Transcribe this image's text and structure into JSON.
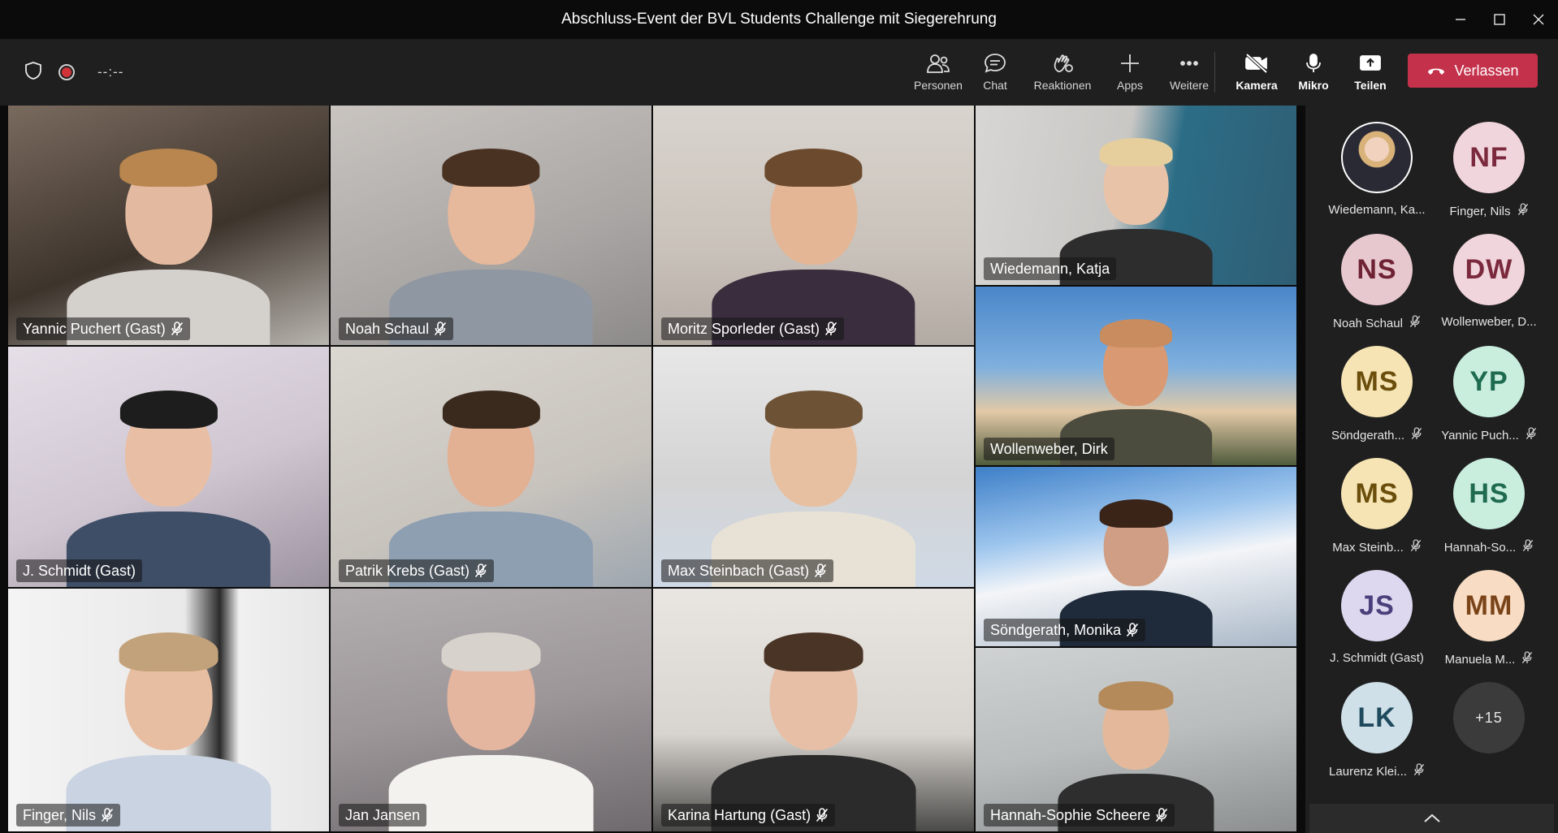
{
  "window": {
    "title": "Abschluss-Event der BVL Students Challenge mit Siegerehrung"
  },
  "toolbar": {
    "timer": "--:--",
    "actions": [
      {
        "label": "Personen",
        "icon": "people-icon"
      },
      {
        "label": "Chat",
        "icon": "chat-icon"
      },
      {
        "label": "Reaktionen",
        "icon": "reactions-icon"
      },
      {
        "label": "Apps",
        "icon": "plus-icon"
      },
      {
        "label": "Weitere",
        "icon": "more-icon"
      }
    ],
    "controls": [
      {
        "label": "Kamera",
        "icon": "camera-off-icon"
      },
      {
        "label": "Mikro",
        "icon": "mic-icon"
      },
      {
        "label": "Teilen",
        "icon": "share-icon"
      }
    ],
    "leave_label": "Verlassen"
  },
  "video_tiles": [
    {
      "name": "Yannic Puchert (Gast)",
      "muted": true
    },
    {
      "name": "Noah Schaul",
      "muted": true
    },
    {
      "name": "Moritz Sporleder (Gast)",
      "muted": true
    },
    {
      "name": "Wiedemann, Katja",
      "muted": false
    },
    {
      "name": "Wollenweber, Dirk",
      "muted": false
    },
    {
      "name": "J. Schmidt (Gast)",
      "muted": false
    },
    {
      "name": "Patrik Krebs (Gast)",
      "muted": true
    },
    {
      "name": "Max Steinbach (Gast)",
      "muted": true
    },
    {
      "name": "Söndgerath, Monika",
      "muted": true
    },
    {
      "name": "Finger, Nils",
      "muted": true
    },
    {
      "name": "Jan Jansen",
      "muted": false
    },
    {
      "name": "Karina Hartung (Gast)",
      "muted": true
    },
    {
      "name": "Hannah-Sophie Scheere",
      "muted": true
    }
  ],
  "participants": [
    {
      "initials": "",
      "name": "Wiedemann, Ka...",
      "muted": false,
      "photo": true
    },
    {
      "initials": "NF",
      "name": "Finger, Nils",
      "muted": true,
      "bg": "#f1d5dc",
      "fg": "#7a2a3c"
    },
    {
      "initials": "NS",
      "name": "Noah Schaul",
      "muted": true,
      "bg": "#e8c8cf",
      "fg": "#6e2233"
    },
    {
      "initials": "DW",
      "name": "Wollenweber, D...",
      "muted": false,
      "bg": "#f1d5dc",
      "fg": "#7a2a3c"
    },
    {
      "initials": "MS",
      "name": "Söndgerath...",
      "muted": true,
      "bg": "#f6e4b4",
      "fg": "#6b4e0c"
    },
    {
      "initials": "YP",
      "name": "Yannic Puch...",
      "muted": true,
      "bg": "#c9eede",
      "fg": "#1f6b4f"
    },
    {
      "initials": "MS",
      "name": "Max Steinb...",
      "muted": true,
      "bg": "#f6e4b4",
      "fg": "#6b4e0c"
    },
    {
      "initials": "HS",
      "name": "Hannah-So...",
      "muted": true,
      "bg": "#c9eede",
      "fg": "#1f6b4f"
    },
    {
      "initials": "JS",
      "name": "J. Schmidt (Gast)",
      "muted": false,
      "bg": "#ddd8ef",
      "fg": "#4a3f7a"
    },
    {
      "initials": "MM",
      "name": "Manuela M...",
      "muted": true,
      "bg": "#f8dcc3",
      "fg": "#7a4418"
    },
    {
      "initials": "LK",
      "name": "Laurenz Klei...",
      "muted": true,
      "bg": "#cfe0e8",
      "fg": "#1f4a5e"
    },
    {
      "initials": "+15",
      "name": "",
      "muted": false,
      "bg": "#3b3b3b",
      "fg": "#e6e6e6"
    }
  ],
  "colors": {
    "leave": "#c4314b",
    "toolbar": "#1f1f1f",
    "recording": "#d13438"
  }
}
